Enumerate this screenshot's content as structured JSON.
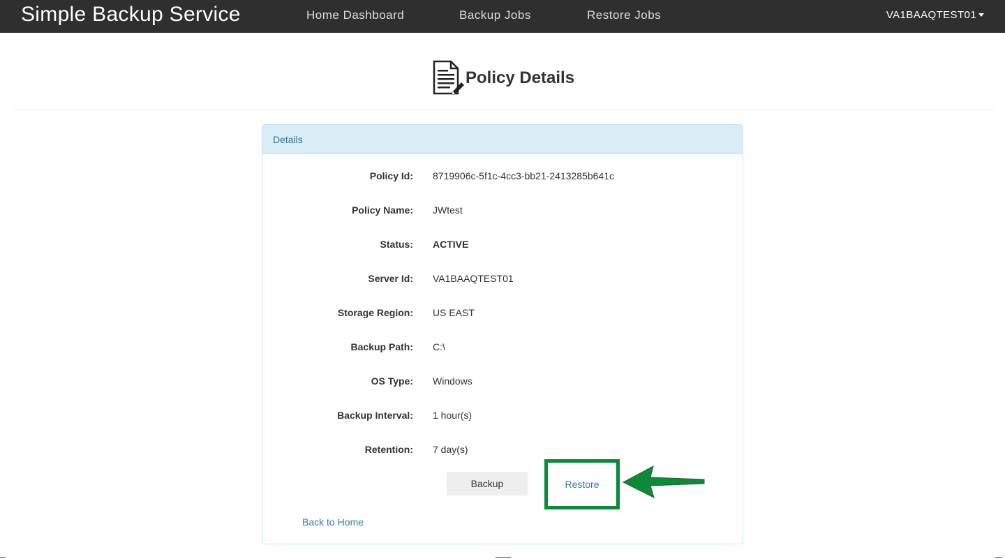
{
  "navbar": {
    "brand": "Simple Backup Service",
    "links": [
      "Home Dashboard",
      "Backup Jobs",
      "Restore Jobs"
    ],
    "user": "VA1BAAQTEST01"
  },
  "page": {
    "title": "Policy Details",
    "icon": "document-edit-icon"
  },
  "panel": {
    "heading": "Details",
    "fields": [
      {
        "label": "Policy Id:",
        "value": "8719906c-5f1c-4cc3-bb21-2413285b641c"
      },
      {
        "label": "Policy Name:",
        "value": "JWtest"
      },
      {
        "label": "Status:",
        "value": "ACTIVE"
      },
      {
        "label": "Server Id:",
        "value": "VA1BAAQTEST01"
      },
      {
        "label": "Storage Region:",
        "value": "US EAST"
      },
      {
        "label": "Backup Path:",
        "value": "C:\\"
      },
      {
        "label": "OS Type:",
        "value": "Windows"
      },
      {
        "label": "Backup Interval:",
        "value": "1 hour(s)"
      },
      {
        "label": "Retention:",
        "value": "7 day(s)"
      }
    ],
    "actions": {
      "backup_label": "Backup",
      "restore_label": "Restore"
    },
    "back_link": "Back to Home"
  },
  "annotation": {
    "highlight_color": "#0b8a3a",
    "arrow_color": "#0b8a3a"
  },
  "colors": {
    "navbar_bg": "#2f2f2f",
    "panel_heading_bg": "#d9edf7",
    "panel_border": "#bce8f1",
    "link": "#337ab7"
  }
}
